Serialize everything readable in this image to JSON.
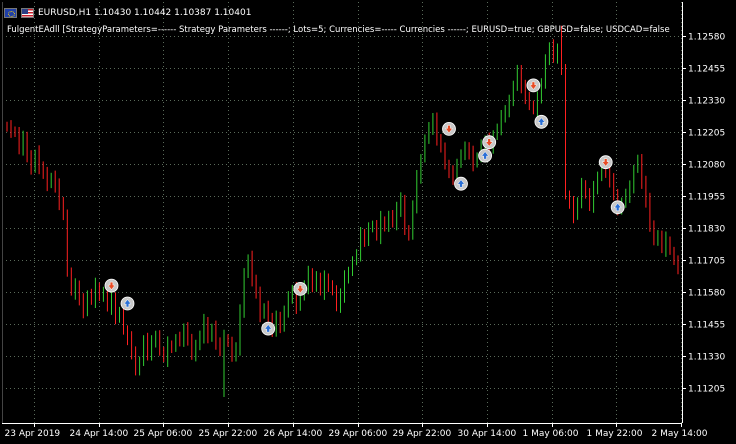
{
  "header": {
    "symbol_info": "EURUSD,H1  1.10430 1.10442 1.10387 1.10401",
    "ea_description": "FulgentEAdll [StrategyParameters=------ Strategy Parameters ------; Lots=5; Currencies=----- Currencies ------; EURUSD=true; GBPUSD=false; USDCAD=false"
  },
  "chart_data": {
    "type": "candlestick",
    "symbol": "EURUSD",
    "timeframe": "H1",
    "ohlc_last": {
      "open": 1.1043,
      "high": 1.10442,
      "low": 1.10387,
      "close": 1.10401
    },
    "y_ticks": [
      "1.12580",
      "1.12455",
      "1.12330",
      "1.12205",
      "1.12080",
      "1.11955",
      "1.11830",
      "1.11705",
      "1.11580",
      "1.11455",
      "1.11330",
      "1.11205"
    ],
    "x_ticks": [
      "23 Apr 2019",
      "24 Apr 14:00",
      "25 Apr 06:00",
      "25 Apr 22:00",
      "26 Apr 14:00",
      "29 Apr 06:00",
      "29 Apr 22:00",
      "30 Apr 14:00",
      "1 May 06:00",
      "1 May 22:00",
      "2 May 14:00"
    ],
    "ylim": [
      1.1113,
      1.1267
    ],
    "grid": true,
    "colors": {
      "bull": "#32cd32",
      "bear": "#ff2020",
      "grid": "#5a6a5a",
      "axis": "#ffffff",
      "background": "#000000",
      "sell_marker": "#e84b24",
      "buy_marker": "#2a6fd6",
      "marker_ring": "#c8c8c8"
    },
    "closes": [
      1.1222,
      1.1221,
      1.122,
      1.1214,
      1.1218,
      1.1211,
      1.1206,
      1.1212,
      1.1207,
      1.1204,
      1.12,
      1.1203,
      1.1199,
      1.1193,
      1.1188,
      1.1166,
      1.1158,
      1.116,
      1.1155,
      1.115,
      1.1157,
      1.1155,
      1.116,
      1.1156,
      1.1158,
      1.1152,
      1.1155,
      1.1148,
      1.115,
      1.1143,
      1.1139,
      1.1135,
      1.1127,
      1.1131,
      1.1139,
      1.1134,
      1.1138,
      1.1141,
      1.1135,
      1.1132,
      1.1137,
      1.1136,
      1.114,
      1.1139,
      1.1143,
      1.114,
      1.1133,
      1.1137,
      1.1141,
      1.1146,
      1.114,
      1.1144,
      1.1138,
      1.1135,
      1.114,
      1.1138,
      1.1133,
      1.1136,
      1.115,
      1.1165,
      1.1171,
      1.1163,
      1.1157,
      1.1149,
      1.1152,
      1.1147,
      1.1143,
      1.1148,
      1.1144,
      1.1151,
      1.1155,
      1.1159,
      1.1152,
      1.1157,
      1.116,
      1.1165,
      1.116,
      1.1164,
      1.1158,
      1.1163,
      1.116,
      1.1159,
      1.1152,
      1.1157,
      1.1163,
      1.1166,
      1.117,
      1.1173,
      1.118,
      1.1178,
      1.1183,
      1.1184,
      1.118,
      1.1186,
      1.1183,
      1.1188,
      1.1185,
      1.119,
      1.1194,
      1.1182,
      1.118,
      1.1192,
      1.1202,
      1.121,
      1.1218,
      1.1222,
      1.1225,
      1.1218,
      1.1214,
      1.1208,
      1.1204,
      1.1203,
      1.1208,
      1.1212,
      1.1214,
      1.1212,
      1.1208,
      1.1211,
      1.1215,
      1.1217,
      1.1214,
      1.1219,
      1.1222,
      1.1226,
      1.1229,
      1.1232,
      1.1239,
      1.1244,
      1.1238,
      1.1234,
      1.1231,
      1.1229,
      1.1233,
      1.124,
      1.1248,
      1.1254,
      1.125,
      1.1252,
      1.1245,
      1.1196,
      1.1192,
      1.1188,
      1.1193,
      1.12,
      1.1196,
      1.1192,
      1.1198,
      1.1203,
      1.1207,
      1.1204,
      1.1202,
      1.1196,
      1.119,
      1.1193,
      1.1196,
      1.1198,
      1.1206,
      1.121,
      1.12,
      1.1194,
      1.1184,
      1.1178,
      1.118,
      1.1175,
      1.1178,
      1.1174,
      1.117,
      1.1167
    ],
    "markers": [
      {
        "type": "sell",
        "bar": 26,
        "price": 1.11605
      },
      {
        "type": "buy",
        "bar": 30,
        "price": 1.11535
      },
      {
        "type": "buy",
        "bar": 65,
        "price": 1.11437
      },
      {
        "type": "sell",
        "bar": 73,
        "price": 1.11592
      },
      {
        "type": "sell",
        "bar": 110,
        "price": 1.12217
      },
      {
        "type": "buy",
        "bar": 113,
        "price": 1.12003
      },
      {
        "type": "buy",
        "bar": 119,
        "price": 1.12113
      },
      {
        "type": "sell",
        "bar": 120,
        "price": 1.12165
      },
      {
        "type": "sell",
        "bar": 131,
        "price": 1.12387
      },
      {
        "type": "buy",
        "bar": 133,
        "price": 1.12245
      },
      {
        "type": "sell",
        "bar": 149,
        "price": 1.12087
      },
      {
        "type": "buy",
        "bar": 152,
        "price": 1.11911
      }
    ]
  }
}
